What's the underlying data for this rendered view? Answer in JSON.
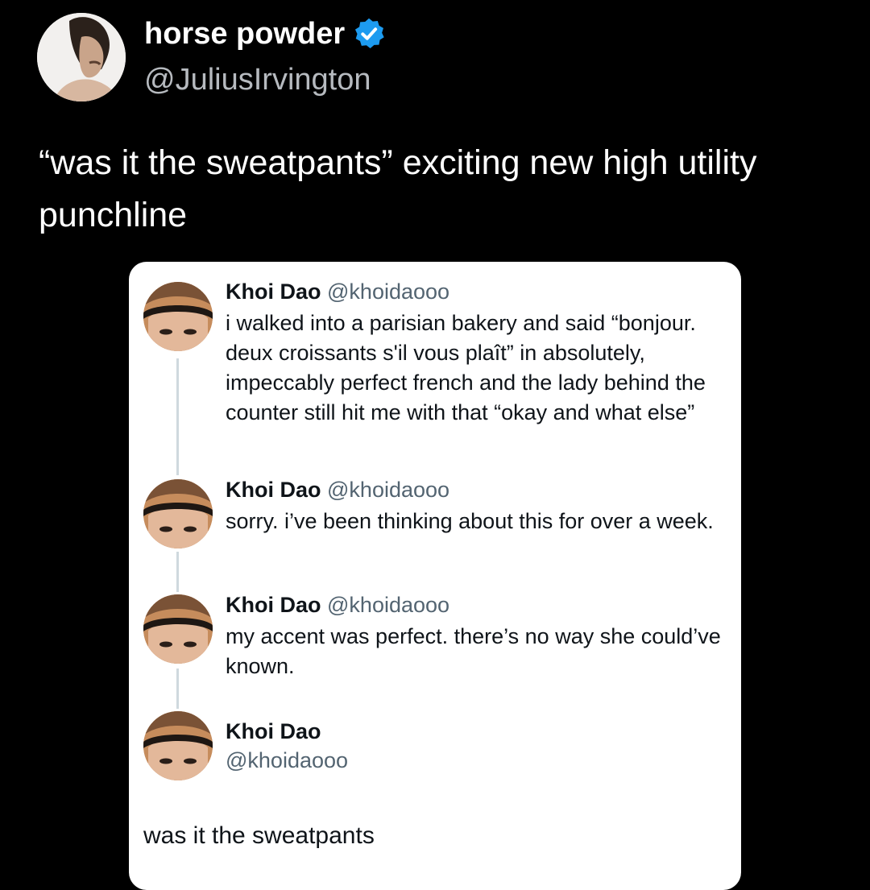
{
  "tweet": {
    "author_name": "horse powder",
    "author_handle": "@JuliusIrvington",
    "text": "“was it the sweatpants” exciting new high utility punchline",
    "verified_color": "#1d9bf0"
  },
  "quoted_thread": {
    "posts": [
      {
        "name": "Khoi Dao",
        "handle": "@khoidaooo",
        "text": "i walked into a parisian bakery and said “bonjour. deux croissants s'il vous plaît” in absolutely, impeccably perfect french and the lady behind the counter still hit me with that “okay and what else”"
      },
      {
        "name": "Khoi Dao",
        "handle": "@khoidaooo",
        "text": "sorry. i’ve been thinking about this for over a week."
      },
      {
        "name": "Khoi Dao",
        "handle": "@khoidaooo",
        "text": "my accent was perfect. there’s no way she could’ve known."
      }
    ],
    "final_post": {
      "name": "Khoi Dao",
      "handle": "@khoidaooo",
      "text": "was it the sweatpants"
    }
  },
  "colors": {
    "background": "#000000",
    "card": "#ffffff",
    "secondary_text": "#536471"
  }
}
